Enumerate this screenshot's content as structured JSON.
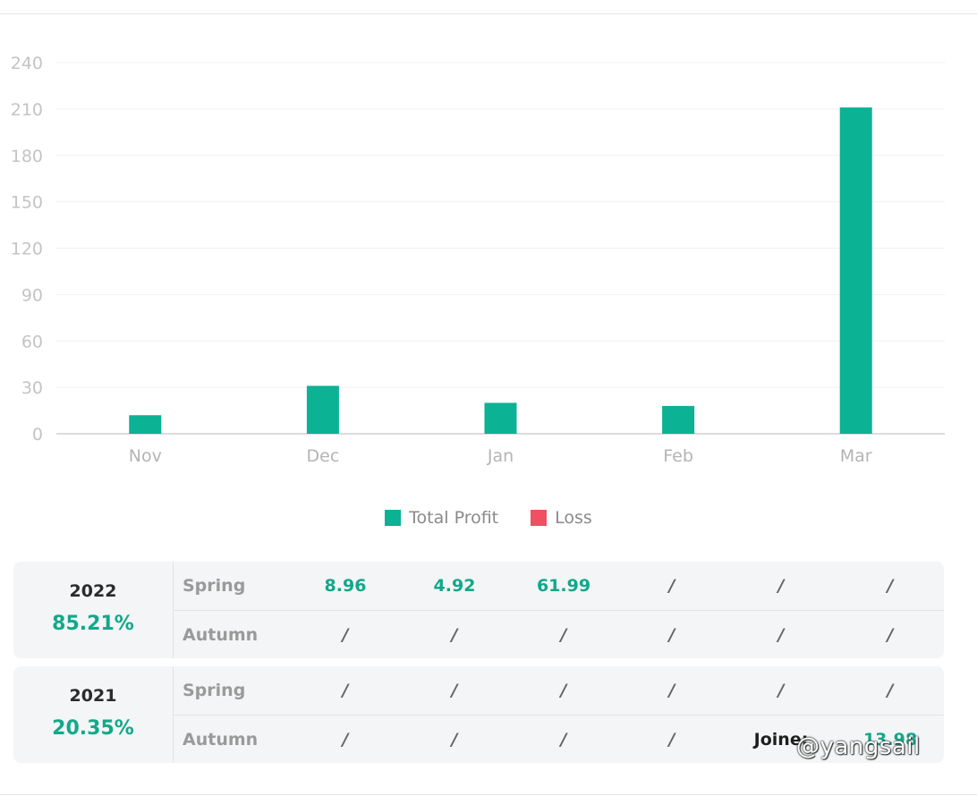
{
  "chart_data": {
    "type": "bar",
    "categories": [
      "Nov",
      "Dec",
      "Jan",
      "Feb",
      "Mar"
    ],
    "series": [
      {
        "name": "Total Profit",
        "color": "#0bb294",
        "values": [
          12,
          31,
          20,
          18,
          211
        ]
      },
      {
        "name": "Loss",
        "color": "#ef5062",
        "values": [
          0,
          0,
          0,
          0,
          0
        ]
      }
    ],
    "yticks": [
      0,
      30,
      60,
      90,
      120,
      150,
      180,
      210,
      240
    ],
    "ylim": [
      0,
      240
    ],
    "grid": true,
    "legend_position": "bottom-center"
  },
  "years": [
    {
      "year": "2022",
      "rate": "85.21%",
      "rows": [
        {
          "season": "Spring",
          "cells": [
            "8.96",
            "4.92",
            "61.99",
            "/",
            "/",
            "/"
          ]
        },
        {
          "season": "Autumn",
          "cells": [
            "/",
            "/",
            "/",
            "/",
            "/",
            "/"
          ]
        }
      ]
    },
    {
      "year": "2021",
      "rate": "20.35%",
      "rows": [
        {
          "season": "Spring",
          "cells": [
            "/",
            "/",
            "/",
            "/",
            "/",
            "/"
          ]
        },
        {
          "season": "Autumn",
          "cells": [
            "/",
            "/",
            "/",
            "/",
            "Joine:",
            "13.98"
          ]
        }
      ]
    }
  ],
  "watermark": "@yangsail"
}
